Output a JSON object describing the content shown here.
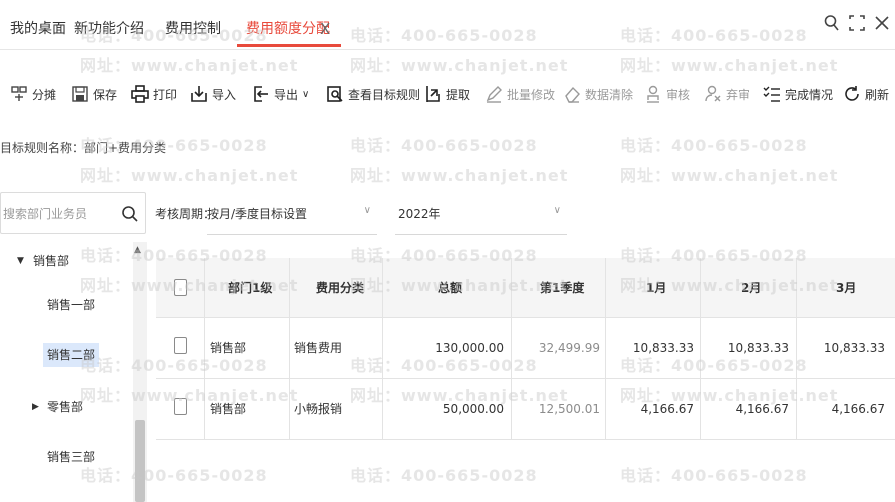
{
  "tabs": [
    {
      "label": "我的桌面",
      "active": false
    },
    {
      "label": "新功能介绍",
      "active": false
    },
    {
      "label": "费用控制",
      "active": false
    },
    {
      "label": "费用额度分配",
      "active": true
    }
  ],
  "tab_close_label": "X",
  "window_icons": [
    "search-icon",
    "fullscreen-icon",
    "close-icon"
  ],
  "toolbar": [
    {
      "label": "分摊",
      "icon": "split-icon",
      "disabled": false
    },
    {
      "label": "保存",
      "icon": "save-icon",
      "disabled": false
    },
    {
      "label": "打印",
      "icon": "print-icon",
      "disabled": false
    },
    {
      "label": "导入",
      "icon": "import-icon",
      "disabled": false
    },
    {
      "label": "导出",
      "icon": "export-icon",
      "disabled": false,
      "dropdown": true
    },
    {
      "label": "查看目标规则",
      "icon": "view-rule-icon",
      "disabled": false
    },
    {
      "label": "提取",
      "icon": "extract-icon",
      "disabled": false
    },
    {
      "label": "批量修改",
      "icon": "edit-icon",
      "disabled": true
    },
    {
      "label": "数据清除",
      "icon": "eraser-icon",
      "disabled": true
    },
    {
      "label": "审核",
      "icon": "audit-icon",
      "disabled": true
    },
    {
      "label": "弃审",
      "icon": "unaudit-icon",
      "disabled": true
    },
    {
      "label": "完成情况",
      "icon": "checklist-icon",
      "disabled": false
    },
    {
      "label": "刷新",
      "icon": "refresh-icon",
      "disabled": false
    }
  ],
  "rule_name": "目标规则名称：部门+费用分类",
  "search": {
    "placeholder": "搜索部门业务员"
  },
  "tree": [
    {
      "label": "销售部",
      "expanded": true
    },
    {
      "label": "销售一部"
    },
    {
      "label": "销售二部",
      "selected": true
    },
    {
      "label": "零售部",
      "expanded": false
    },
    {
      "label": "销售三部"
    }
  ],
  "filters": {
    "period_label": "考核周期：",
    "period_value": "按月/季度目标设置",
    "year_value": "2022年"
  },
  "grid": {
    "columns": [
      "部门1级",
      "费用分类",
      "总额",
      "第1季度",
      "1月",
      "2月",
      "3月"
    ],
    "rows": [
      [
        "销售部",
        "销售费用",
        "130,000.00",
        "32,499.99",
        "10,833.33",
        "10,833.33",
        "10,833.33"
      ],
      [
        "销售部",
        "小畅报销",
        "50,000.00",
        "12,500.01",
        "4,166.67",
        "4,166.67",
        "4,166.67"
      ]
    ]
  },
  "watermark": {
    "phone": "电话：400-665-0028",
    "site": "网址：www.chanjet.net"
  },
  "colors": {
    "accent": "#e84a3c",
    "selected_bg": "#dbe8fb",
    "header_bg": "#f5f5f5"
  }
}
